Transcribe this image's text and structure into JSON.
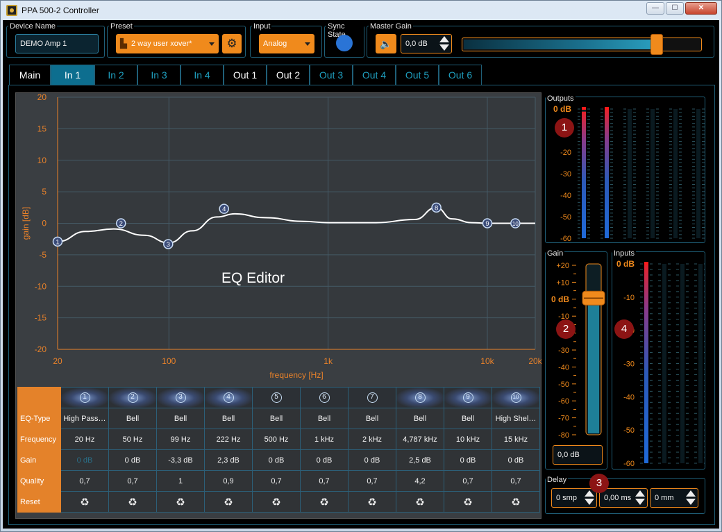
{
  "window": {
    "title": "PPA 500-2 Controller"
  },
  "header": {
    "device_name_label": "Device Name",
    "device_name_value": "DEMO Amp 1",
    "preset_label": "Preset",
    "preset_value": "2 way user xover*",
    "input_label": "Input",
    "input_value": "Analog",
    "sync_label": "Sync State",
    "master_gain_label": "Master Gain",
    "master_gain_value": "0,0 dB",
    "master_gain_slider_fraction": 0.82
  },
  "tabs": [
    {
      "label": "Main",
      "state": "on"
    },
    {
      "label": "In 1",
      "state": "selected"
    },
    {
      "label": "In 2",
      "state": "off"
    },
    {
      "label": "In 3",
      "state": "off"
    },
    {
      "label": "In 4",
      "state": "off"
    },
    {
      "label": "Out 1",
      "state": "on"
    },
    {
      "label": "Out 2",
      "state": "on"
    },
    {
      "label": "Out 3",
      "state": "off"
    },
    {
      "label": "Out 4",
      "state": "off"
    },
    {
      "label": "Out 5",
      "state": "off"
    },
    {
      "label": "Out 6",
      "state": "off"
    }
  ],
  "eq_chart": {
    "overlay_label": "EQ Editor",
    "xlabel": "frequency [Hz]",
    "ylabel": "gain [dB]",
    "y_ticks": [
      "20",
      "15",
      "10",
      "5",
      "0",
      "-5",
      "-10",
      "-15",
      "-20"
    ],
    "x_ticks": [
      "20",
      "100",
      "1k",
      "10k",
      "20k"
    ]
  },
  "chart_data": {
    "type": "line",
    "xlabel": "frequency [Hz]",
    "ylabel": "gain [dB]",
    "x_scale": "log",
    "xlim": [
      20,
      20000
    ],
    "ylim": [
      -20,
      20
    ],
    "grid": true,
    "points": [
      {
        "label": "1",
        "freq": 20,
        "gain": -2.9
      },
      {
        "label": "2",
        "freq": 50,
        "gain": 0
      },
      {
        "label": "3",
        "freq": 99,
        "gain": -3.3
      },
      {
        "label": "4",
        "freq": 222,
        "gain": 2.3
      },
      {
        "label": "8",
        "freq": 4787,
        "gain": 2.5
      },
      {
        "label": "9",
        "freq": 10000,
        "gain": 0
      },
      {
        "label": "10",
        "freq": 15000,
        "gain": 0
      }
    ],
    "curve": [
      [
        20,
        -2.9
      ],
      [
        30,
        -1.3
      ],
      [
        45,
        -0.9
      ],
      [
        70,
        -1.9
      ],
      [
        100,
        -3.1
      ],
      [
        140,
        -1.2
      ],
      [
        200,
        1.0
      ],
      [
        260,
        1.5
      ],
      [
        400,
        0.9
      ],
      [
        700,
        0.3
      ],
      [
        1000,
        0.1
      ],
      [
        2000,
        0.1
      ],
      [
        3500,
        0.6
      ],
      [
        4787,
        2.5
      ],
      [
        6000,
        0.7
      ],
      [
        8000,
        0.1
      ],
      [
        10000,
        0
      ],
      [
        20000,
        0
      ]
    ]
  },
  "eq_table": {
    "row_labels": [
      "EQ-Type",
      "Frequency",
      "Gain",
      "Quality",
      "Reset"
    ],
    "bands": [
      {
        "num": "1",
        "type": "High Pass…",
        "freq": "20 Hz",
        "gain": "0 dB",
        "q": "0,7",
        "active": true
      },
      {
        "num": "2",
        "type": "Bell",
        "freq": "50 Hz",
        "gain": "0 dB",
        "q": "0,7",
        "active": true
      },
      {
        "num": "3",
        "type": "Bell",
        "freq": "99 Hz",
        "gain": "-3,3 dB",
        "q": "1",
        "active": true
      },
      {
        "num": "4",
        "type": "Bell",
        "freq": "222 Hz",
        "gain": "2,3 dB",
        "q": "0,9",
        "active": true
      },
      {
        "num": "5",
        "type": "Bell",
        "freq": "500 Hz",
        "gain": "0 dB",
        "q": "0,7",
        "active": false
      },
      {
        "num": "6",
        "type": "Bell",
        "freq": "1 kHz",
        "gain": "0 dB",
        "q": "0,7",
        "active": false
      },
      {
        "num": "7",
        "type": "Bell",
        "freq": "2 kHz",
        "gain": "0 dB",
        "q": "0,7",
        "active": false
      },
      {
        "num": "8",
        "type": "Bell",
        "freq": "4,787 kHz",
        "gain": "2,5 dB",
        "q": "4,2",
        "active": true
      },
      {
        "num": "9",
        "type": "Bell",
        "freq": "10 kHz",
        "gain": "0 dB",
        "q": "0,7",
        "active": true
      },
      {
        "num": "10",
        "type": "High Shel…",
        "freq": "15 kHz",
        "gain": "0 dB",
        "q": "0,7",
        "active": true
      }
    ]
  },
  "outputs_meter": {
    "label": "Outputs",
    "top_label": "0 dB",
    "scale": [
      "-10",
      "-20",
      "-30",
      "-40",
      "-50",
      "-60"
    ],
    "levels": [
      0.98,
      1.0,
      0,
      0,
      0,
      0
    ]
  },
  "gain_fader": {
    "label": "Gain",
    "top_label": "+20",
    "scale": [
      "+10",
      "0 dB",
      "-10",
      "-20",
      "-30",
      "-40",
      "-50",
      "-60",
      "-70",
      "-80"
    ],
    "value": "0,0 dB",
    "position_fraction": 0.2
  },
  "inputs_meter": {
    "label": "Inputs",
    "top_label": "0 dB",
    "scale": [
      "-10",
      "-20",
      "-30",
      "-40",
      "-50",
      "-60"
    ],
    "levels": [
      1.0,
      0,
      0,
      0
    ]
  },
  "delay": {
    "label": "Delay",
    "samples": "0 smp",
    "ms": "0,00 ms",
    "mm": "0 mm"
  },
  "markers": [
    "1",
    "2",
    "3",
    "4"
  ]
}
